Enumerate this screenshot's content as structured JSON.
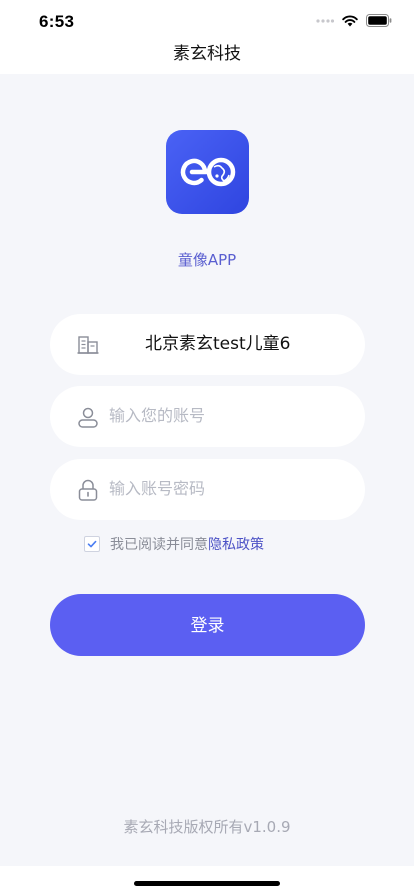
{
  "status_bar": {
    "time": "6:53",
    "icons": [
      "signal-icon",
      "wifi-icon",
      "battery-icon"
    ]
  },
  "nav": {
    "title": "素玄科技"
  },
  "app": {
    "logo_icon": "app-logo-icon",
    "name": "童像APP"
  },
  "form": {
    "organization": {
      "icon": "building-icon",
      "value": "北京素玄test儿童6"
    },
    "account": {
      "icon": "user-icon",
      "placeholder": "输入您的账号",
      "value": ""
    },
    "password": {
      "icon": "lock-icon",
      "placeholder": "输入账号密码",
      "value": ""
    },
    "agreement": {
      "checked": true,
      "text": "我已阅读并同意",
      "link_text": "隐私政策"
    },
    "login_label": "登录"
  },
  "footer": {
    "copyright": "素玄科技版权所有v1.0.9"
  },
  "colors": {
    "accent": "#5b5ff2",
    "link": "#4d53c6",
    "logo_bg": "#3d55ec",
    "background": "#f5f6fa"
  }
}
